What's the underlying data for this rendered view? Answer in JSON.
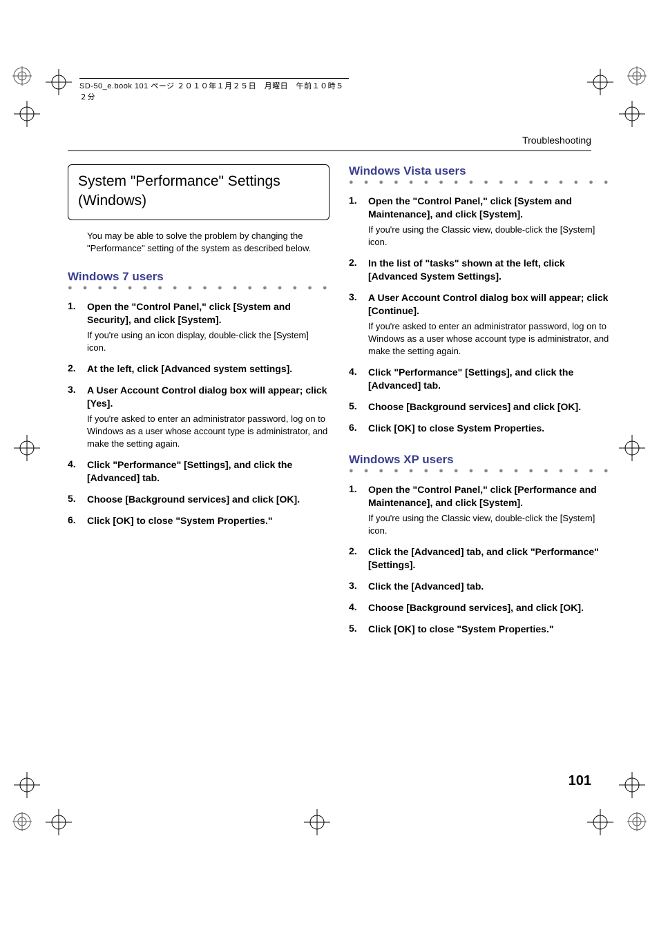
{
  "meta_line": "SD-50_e.book  101 ページ  ２０１０年１月２５日　月曜日　午前１０時５２分",
  "running_head": "Troubleshooting",
  "page_number": "101",
  "section_title": "System \"Performance\" Settings (Windows)",
  "intro": "You may be able to solve the problem by changing the \"Performance\" setting of the system as described below.",
  "dots": "● ● ● ● ● ● ● ● ● ● ● ● ● ● ● ● ● ● ● ● ● ● ● ● ● ● ● ● ● ●",
  "win7": {
    "title": "Windows 7 users",
    "steps": [
      {
        "bold": "Open the \"Control Panel,\" click [System and Security], and click [System].",
        "note": "If you're using an icon display, double-click the [System] icon."
      },
      {
        "bold": "At the left, click [Advanced system settings]."
      },
      {
        "bold": "A User Account Control dialog box will appear; click [Yes].",
        "note": "If you're asked to enter an administrator password, log on to Windows as a user whose account type is administrator, and make the setting again."
      },
      {
        "bold": "Click \"Performance\" [Settings], and click the [Advanced] tab."
      },
      {
        "bold": "Choose [Background services] and click [OK]."
      },
      {
        "bold": "Click [OK] to close \"System Properties.\""
      }
    ]
  },
  "vista": {
    "title": "Windows Vista users",
    "steps": [
      {
        "bold": "Open the \"Control Panel,\" click [System and Maintenance], and click [System].",
        "note": "If you're using the Classic view, double-click the [System] icon."
      },
      {
        "bold": "In the list of \"tasks\" shown at the left, click [Advanced System Settings]."
      },
      {
        "bold": "A User Account Control dialog box will appear; click [Continue].",
        "note": "If you're asked to enter an administrator password, log on to Windows as a user whose account type is administrator, and make the setting again."
      },
      {
        "bold": "Click \"Performance\" [Settings], and click the [Advanced] tab."
      },
      {
        "bold": "Choose [Background services] and click [OK]."
      },
      {
        "bold": "Click [OK] to close System Properties."
      }
    ]
  },
  "xp": {
    "title": "Windows XP users",
    "steps": [
      {
        "bold": "Open the \"Control Panel,\" click [Performance and Maintenance], and click [System].",
        "note": "If you're using the Classic view, double-click the [System] icon."
      },
      {
        "bold": "Click the [Advanced] tab, and click \"Performance\" [Settings]."
      },
      {
        "bold": "Click the [Advanced] tab."
      },
      {
        "bold": "Choose [Background services], and click [OK]."
      },
      {
        "bold": "Click [OK] to close \"System Properties.\""
      }
    ]
  }
}
